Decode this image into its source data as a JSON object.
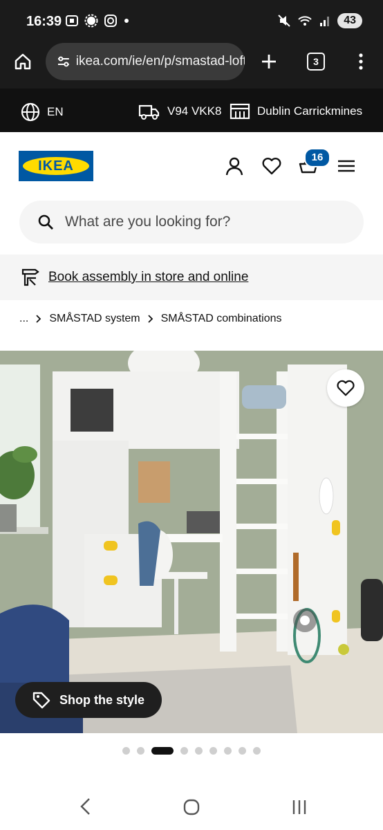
{
  "status": {
    "time": "16:39",
    "battery": "43"
  },
  "browser": {
    "url": "ikea.com/ie/en/p/smastad-loft",
    "tab_count": "3"
  },
  "utility": {
    "language": "EN",
    "postcode": "V94 VKK8",
    "store": "Dublin Carrickmines"
  },
  "header": {
    "logo_text": "IKEA",
    "cart_count": "16"
  },
  "search": {
    "placeholder": "What are you looking for?"
  },
  "assembly": {
    "link": "Book assembly in store and online"
  },
  "breadcrumb": {
    "ellipsis": "...",
    "item1": "SMÅSTAD system",
    "item2": "SMÅSTAD combinations"
  },
  "hero": {
    "shop_style_label": "Shop the style",
    "total_slides": 9,
    "active_slide": 3
  },
  "colors": {
    "ikea_blue": "#0058a3",
    "ikea_yellow": "#ffdb00"
  }
}
